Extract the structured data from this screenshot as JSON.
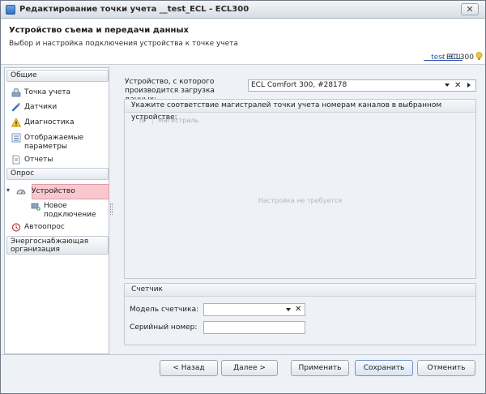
{
  "window": {
    "title": "Редактирование точки учета __test_ECL - ECL300",
    "close_glyph": "✕"
  },
  "header": {
    "title": "Устройство съема и передачи данных",
    "subtitle": "Выбор и настройка подключения устройства к точке учета",
    "link_text": "__test_ECL",
    "link_suffix": " - ECL300"
  },
  "sidebar": {
    "groups": {
      "general": "Общие",
      "poll": "Опрос",
      "energy": "Энергоснабжающая организация"
    },
    "items": {
      "metering_point": "Точка учета",
      "sensors": "Датчики",
      "diagnostics": "Диагностика",
      "displayed_params": "Отображаемые параметры",
      "reports": "Отчеты",
      "device": "Устройство",
      "new_connection": "Новое подключение",
      "autopoll": "Автоопрос"
    },
    "expand_glyph": "▾"
  },
  "main": {
    "device_label": "Устройство, с которого производится загрузка данных:",
    "device_value": "ECL Comfort 300, #28178",
    "mapping_title": "Укажите соответствие магистралей точки учета номерам каналов в выбранном устройстве:",
    "col_number": "№",
    "col_line": "Магистраль",
    "empty_message": "Настройка не требуется",
    "meter": {
      "title": "Счетчик",
      "model_label": "Модель счетчика:",
      "model_value": "",
      "serial_label": "Серийный номер:",
      "serial_value": ""
    },
    "clear_glyph": "✕"
  },
  "footer": {
    "back": "< Назад",
    "next": "Далее >",
    "apply": "Применить",
    "save": "Сохранить",
    "cancel": "Отменить"
  }
}
